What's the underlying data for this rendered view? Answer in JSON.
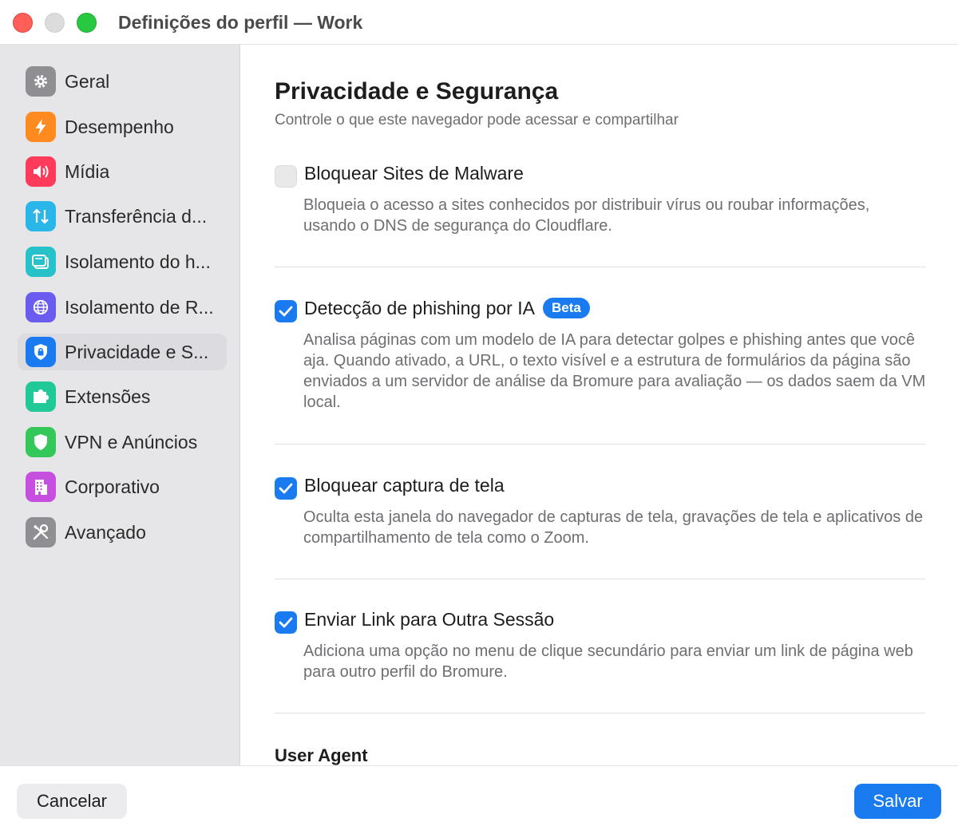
{
  "window": {
    "title": "Definições do perfil — Work"
  },
  "sidebar": {
    "selected_index": 6,
    "items": [
      {
        "label": "Geral",
        "icon": "gear-icon",
        "color": "#8e8e93"
      },
      {
        "label": "Desempenho",
        "icon": "bolt-icon",
        "color": "#ff8a1f"
      },
      {
        "label": "Mídia",
        "icon": "speaker-icon",
        "color": "#ff3b5c"
      },
      {
        "label": "Transferência d...",
        "icon": "transfer-arrows-icon",
        "color": "#29b6e8"
      },
      {
        "label": "Isolamento do h...",
        "icon": "window-icon",
        "color": "#26c1c9"
      },
      {
        "label": "Isolamento de R...",
        "icon": "globe-icon",
        "color": "#6b5cf0"
      },
      {
        "label": "Privacidade e S...",
        "icon": "lock-icon",
        "color": "#1a7af0"
      },
      {
        "label": "Extensões",
        "icon": "puzzle-icon",
        "color": "#20c997"
      },
      {
        "label": "VPN e Anúncios",
        "icon": "shield-icon",
        "color": "#34c759"
      },
      {
        "label": "Corporativo",
        "icon": "building-icon",
        "color": "#c64fe0"
      },
      {
        "label": "Avançado",
        "icon": "tools-icon",
        "color": "#8e8e93"
      }
    ]
  },
  "main": {
    "heading": "Privacidade e Segurança",
    "subheading": "Controle o que este navegador pode acessar e compartilhar",
    "settings": [
      {
        "title": "Bloquear Sites de Malware",
        "checked": false,
        "description": "Bloqueia o acesso a sites conhecidos por distribuir vírus ou roubar informações, usando o DNS de segurança do Cloudflare."
      },
      {
        "title": "Detecção de phishing por IA",
        "badge": "Beta",
        "checked": true,
        "description": "Analisa páginas com um modelo de IA para detectar golpes e phishing antes que você aja. Quando ativado, a URL, o texto visível e a estrutura de formulários da página são enviados a um servidor de análise da Bromure para avaliação — os dados saem da VM local."
      },
      {
        "title": "Bloquear captura de tela",
        "checked": true,
        "description": "Oculta esta janela do navegador de capturas de tela, gravações de tela e aplicativos de compartilhamento de tela como o Zoom."
      },
      {
        "title": "Enviar Link para Outra Sessão",
        "checked": true,
        "description": "Adiciona uma opção no menu de clique secundário para enviar um link de página web para outro perfil do Bromure."
      }
    ],
    "next_section_title": "User Agent"
  },
  "footer": {
    "cancel_label": "Cancelar",
    "save_label": "Salvar"
  }
}
